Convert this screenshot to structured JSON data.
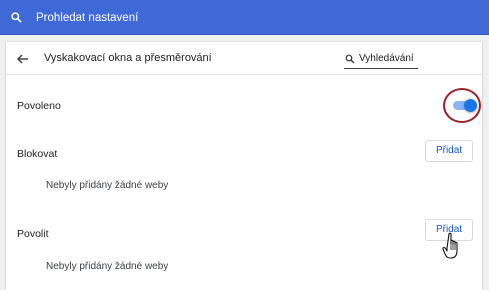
{
  "topbar": {
    "search_placeholder": "Prohledat nastavení",
    "icon": "search-icon"
  },
  "header": {
    "title": "Vyskakovací okna a přesměrování",
    "back_icon": "arrow-left-icon",
    "search_text": "Vyhledávání"
  },
  "allowed_toggle": {
    "label": "Povoleno",
    "state": true
  },
  "block_section": {
    "label": "Blokovat",
    "add_button": "Přidat",
    "empty_text": "Nebyly přidány žádné weby"
  },
  "allow_section": {
    "label": "Povolit",
    "add_button": "Přidat",
    "empty_text": "Nebyly přidány žádné weby"
  },
  "colors": {
    "topbar": "#3f69d6",
    "accent": "#1a73e8",
    "highlight": "#9b2226"
  }
}
